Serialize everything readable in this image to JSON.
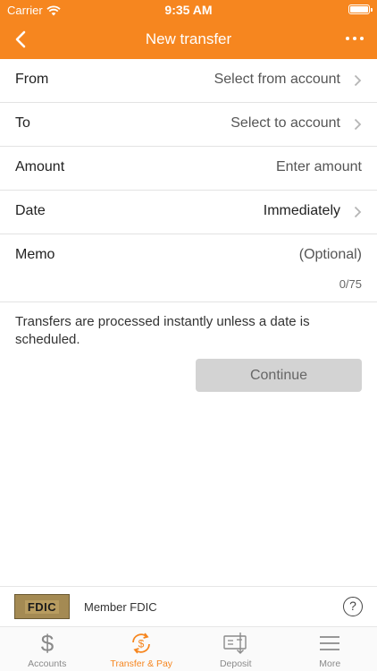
{
  "status_bar": {
    "carrier": "Carrier",
    "time": "9:35 AM"
  },
  "nav": {
    "title": "New transfer",
    "back_icon": "chevron-left-icon",
    "more_icon": "ellipsis-icon"
  },
  "form": {
    "from": {
      "label": "From",
      "value": "Select from account"
    },
    "to": {
      "label": "To",
      "value": "Select to account"
    },
    "amount": {
      "label": "Amount",
      "placeholder": "Enter amount"
    },
    "date": {
      "label": "Date",
      "value": "Immediately"
    },
    "memo": {
      "label": "Memo",
      "placeholder": "(Optional)",
      "counter": "0/75"
    }
  },
  "note": "Transfers are processed instantly unless a date is scheduled.",
  "continue_label": "Continue",
  "footer": {
    "logo_text": "FDIC",
    "member_text": "Member FDIC",
    "help": "?"
  },
  "tabs": [
    {
      "label": "Accounts",
      "icon": "dollar-icon",
      "active": false
    },
    {
      "label": "Transfer & Pay",
      "icon": "transfer-dollar-icon",
      "active": true
    },
    {
      "label": "Deposit",
      "icon": "check-deposit-icon",
      "active": false
    },
    {
      "label": "More",
      "icon": "menu-icon",
      "active": false
    }
  ],
  "colors": {
    "accent": "#f6861f",
    "button_disabled": "#d3d3d3"
  }
}
